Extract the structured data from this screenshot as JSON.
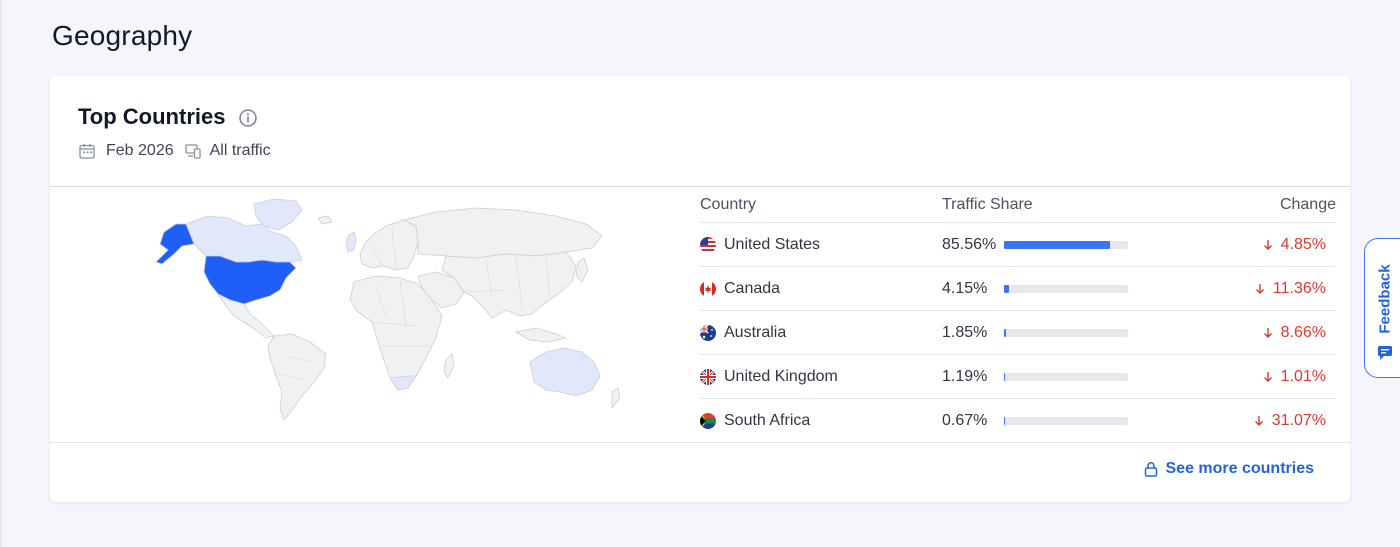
{
  "section": {
    "title": "Geography"
  },
  "card": {
    "title": "Top Countries",
    "date_label": "Feb 2026",
    "traffic_label": "All traffic"
  },
  "table": {
    "columns": {
      "country": "Country",
      "share": "Traffic Share",
      "change": "Change"
    },
    "rows": [
      {
        "country": "United States",
        "share": "85.56%",
        "share_value": 85.56,
        "change": "4.85%",
        "direction": "down"
      },
      {
        "country": "Canada",
        "share": "4.15%",
        "share_value": 4.15,
        "change": "11.36%",
        "direction": "down"
      },
      {
        "country": "Australia",
        "share": "1.85%",
        "share_value": 1.85,
        "change": "8.66%",
        "direction": "down"
      },
      {
        "country": "United Kingdom",
        "share": "1.19%",
        "share_value": 1.19,
        "change": "1.01%",
        "direction": "down"
      },
      {
        "country": "South Africa",
        "share": "0.67%",
        "share_value": 0.67,
        "change": "31.07%",
        "direction": "down"
      }
    ]
  },
  "see_more": {
    "label": "See more countries"
  },
  "feedback": {
    "label": "Feedback"
  },
  "colors": {
    "accent": "#2563d9",
    "bar_fill": "#3b74f0",
    "bar_track": "#e6e8ee",
    "negative": "#d93b30",
    "map_highlight": "#1f5ef7",
    "map_light": "#e1e8fb",
    "map_base": "#f0f1f3"
  }
}
